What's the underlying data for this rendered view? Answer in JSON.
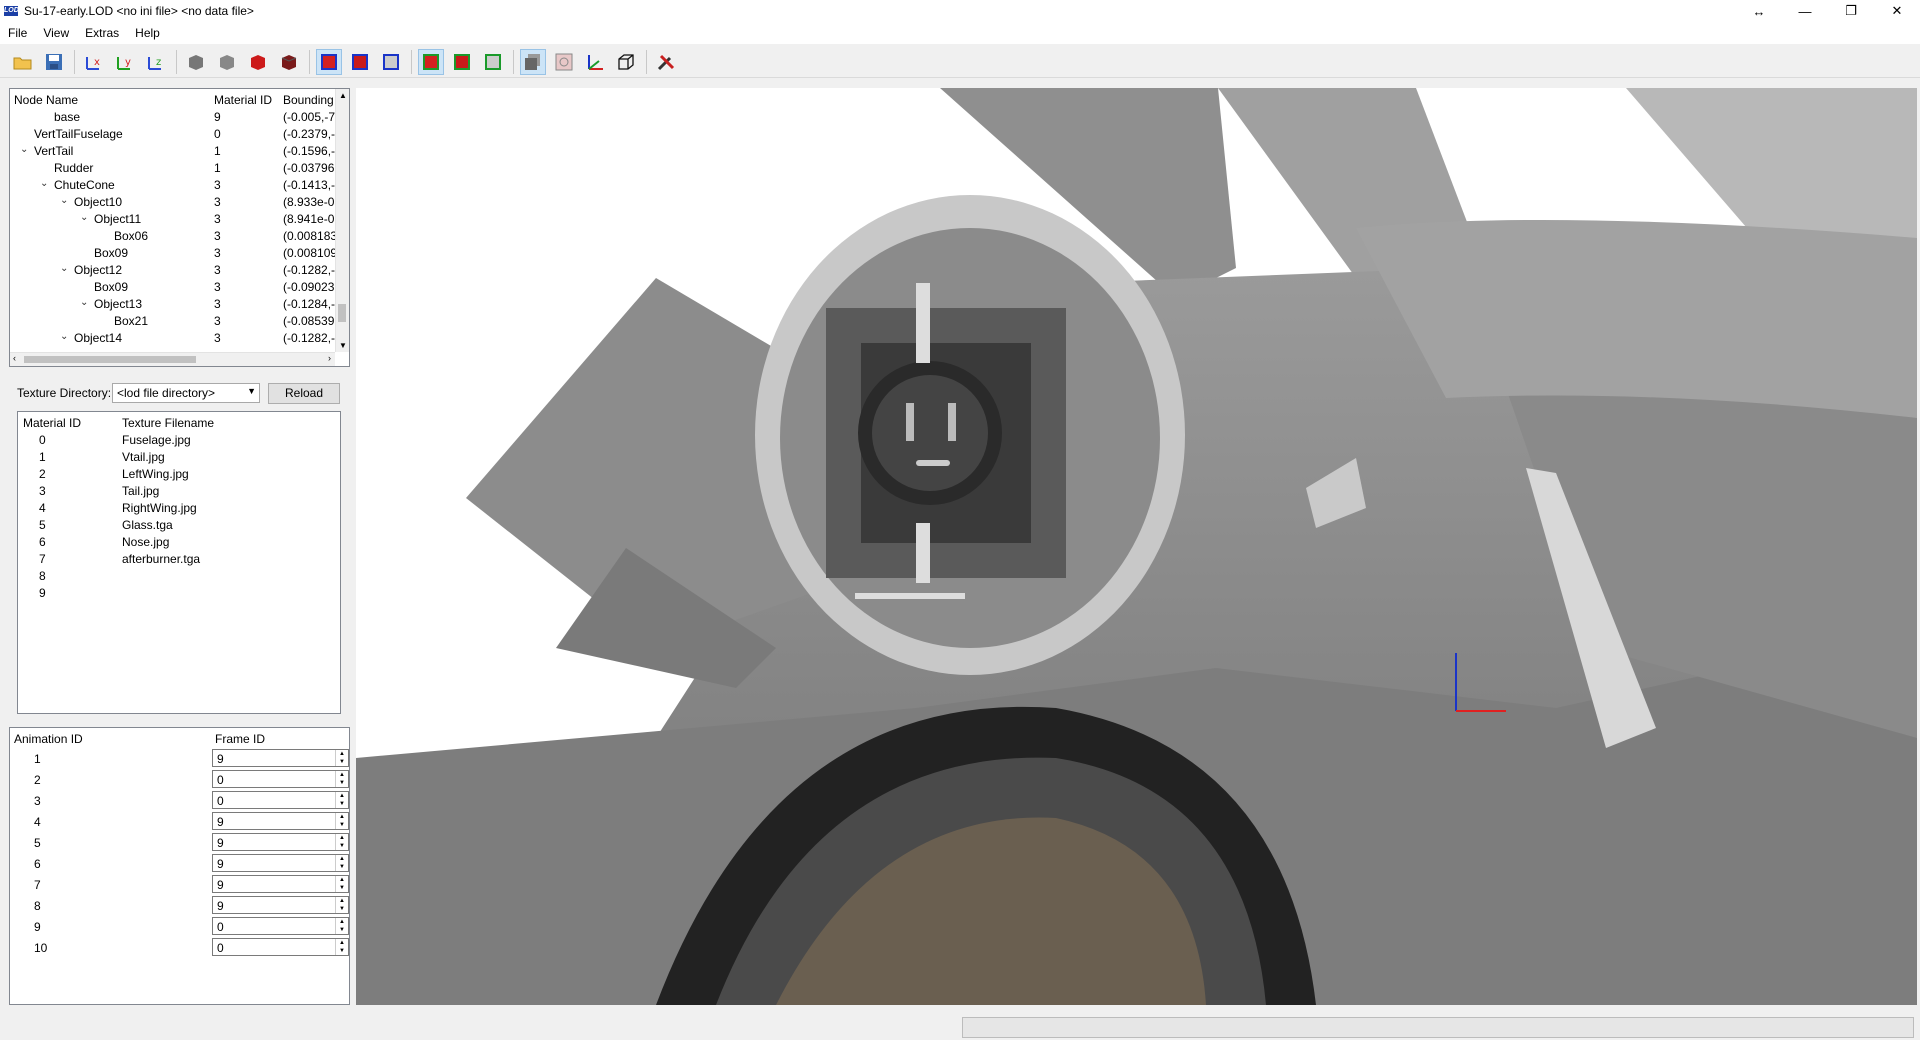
{
  "window": {
    "title": "Su-17-early.LOD  <no ini file>  <no data file>",
    "logo_text": "LOD"
  },
  "menu": [
    "File",
    "View",
    "Extras",
    "Help"
  ],
  "toolbar": {
    "icons": [
      "open-icon",
      "save-icon",
      "rotate-x-icon",
      "rotate-y-icon",
      "rotate-z-icon",
      "render-shaded-icon",
      "render-flat-icon",
      "render-solid-icon",
      "render-textured-icon",
      "view-mode-1-icon",
      "view-mode-2-icon",
      "view-mode-3-icon",
      "light-mode-1-icon",
      "light-mode-2-icon",
      "light-mode-3-icon",
      "background-icon",
      "camera-icon",
      "axes-icon",
      "bounding-box-icon",
      "tools-icon"
    ]
  },
  "node_tree": {
    "columns": [
      "Node Name",
      "Material ID",
      "Bounding"
    ],
    "rows": [
      {
        "name": "base",
        "mat": "9",
        "bound": "(-0.005,-7",
        "depth": 2,
        "caret": ""
      },
      {
        "name": "VertTailFuselage",
        "mat": "0",
        "bound": "(-0.2379,-",
        "depth": 1,
        "caret": ""
      },
      {
        "name": "VertTail",
        "mat": "1",
        "bound": "(-0.1596,-",
        "depth": 1,
        "caret": "v"
      },
      {
        "name": "Rudder",
        "mat": "1",
        "bound": "(-0.03796,",
        "depth": 2,
        "caret": ""
      },
      {
        "name": "ChuteCone",
        "mat": "3",
        "bound": "(-0.1413,-",
        "depth": 2,
        "caret": "v"
      },
      {
        "name": "Object10",
        "mat": "3",
        "bound": "(8.933e-0",
        "depth": 3,
        "caret": "v"
      },
      {
        "name": "Object11",
        "mat": "3",
        "bound": "(8.941e-0",
        "depth": 4,
        "caret": "v"
      },
      {
        "name": "Box06",
        "mat": "3",
        "bound": "(0.008183",
        "depth": 5,
        "caret": ""
      },
      {
        "name": "Box09",
        "mat": "3",
        "bound": "(0.008109",
        "depth": 4,
        "caret": ""
      },
      {
        "name": "Object12",
        "mat": "3",
        "bound": "(-0.1282,-",
        "depth": 3,
        "caret": "v"
      },
      {
        "name": "Box09",
        "mat": "3",
        "bound": "(-0.09023,",
        "depth": 4,
        "caret": ""
      },
      {
        "name": "Object13",
        "mat": "3",
        "bound": "(-0.1284,-",
        "depth": 4,
        "caret": "v"
      },
      {
        "name": "Box21",
        "mat": "3",
        "bound": "(-0.08539,",
        "depth": 5,
        "caret": ""
      },
      {
        "name": "Object14",
        "mat": "3",
        "bound": "(-0.1282,-",
        "depth": 3,
        "caret": "v"
      }
    ]
  },
  "texture": {
    "dir_label": "Texture Directory:",
    "dir_value": "<lod file directory>",
    "reload_label": "Reload",
    "columns": [
      "Material ID",
      "Texture Filename"
    ],
    "rows": [
      {
        "id": "0",
        "file": "Fuselage.jpg"
      },
      {
        "id": "1",
        "file": "Vtail.jpg"
      },
      {
        "id": "2",
        "file": "LeftWing.jpg"
      },
      {
        "id": "3",
        "file": "Tail.jpg"
      },
      {
        "id": "4",
        "file": "RightWing.jpg"
      },
      {
        "id": "5",
        "file": "Glass.tga"
      },
      {
        "id": "6",
        "file": "Nose.jpg"
      },
      {
        "id": "7",
        "file": "afterburner.tga"
      },
      {
        "id": "8",
        "file": ""
      },
      {
        "id": "9",
        "file": ""
      }
    ]
  },
  "animation": {
    "columns": [
      "Animation ID",
      "Frame ID"
    ],
    "rows": [
      {
        "id": "1",
        "frame": "9"
      },
      {
        "id": "2",
        "frame": "0"
      },
      {
        "id": "3",
        "frame": "0"
      },
      {
        "id": "4",
        "frame": "9"
      },
      {
        "id": "5",
        "frame": "9"
      },
      {
        "id": "6",
        "frame": "9"
      },
      {
        "id": "7",
        "frame": "9"
      },
      {
        "id": "8",
        "frame": "9"
      },
      {
        "id": "9",
        "frame": "0"
      },
      {
        "id": "10",
        "frame": "0"
      }
    ]
  },
  "colors": {
    "model_gray": "#8a8a8a",
    "axis_x": "#e02020",
    "axis_y": "#2020e0"
  }
}
